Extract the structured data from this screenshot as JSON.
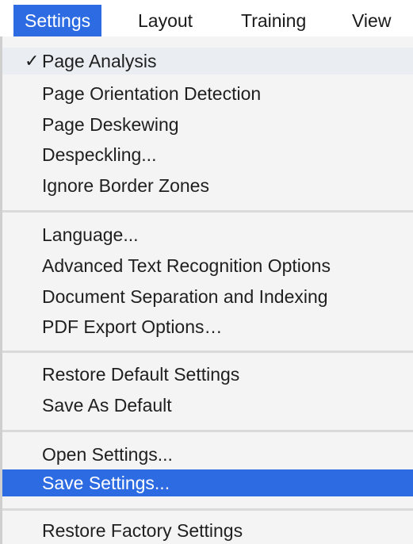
{
  "menubar": {
    "items": [
      {
        "label": "Settings",
        "active": true
      },
      {
        "label": "Layout",
        "active": false
      },
      {
        "label": "Training",
        "active": false
      },
      {
        "label": "View",
        "active": false
      }
    ]
  },
  "menu": {
    "check_mark": "✓",
    "groups": [
      [
        {
          "label": "Page Analysis",
          "checked": true
        },
        {
          "label": "Page Orientation Detection",
          "checked": false
        },
        {
          "label": "Page Deskewing",
          "checked": false
        },
        {
          "label": "Despeckling...",
          "checked": false
        },
        {
          "label": "Ignore Border Zones",
          "checked": false
        }
      ],
      [
        {
          "label": "Language..."
        },
        {
          "label": "Advanced Text Recognition Options"
        },
        {
          "label": "Document Separation and Indexing"
        },
        {
          "label": "PDF Export Options…"
        }
      ],
      [
        {
          "label": "Restore Default Settings"
        },
        {
          "label": "Save As Default"
        }
      ],
      [
        {
          "label": "Open Settings..."
        },
        {
          "label": "Save Settings...",
          "highlighted": true
        }
      ],
      [
        {
          "label": "Restore Factory Settings"
        }
      ]
    ]
  },
  "colors": {
    "accent": "#2d6be3",
    "menu_background": "#f4f4f4",
    "text": "#1f1f1f"
  }
}
